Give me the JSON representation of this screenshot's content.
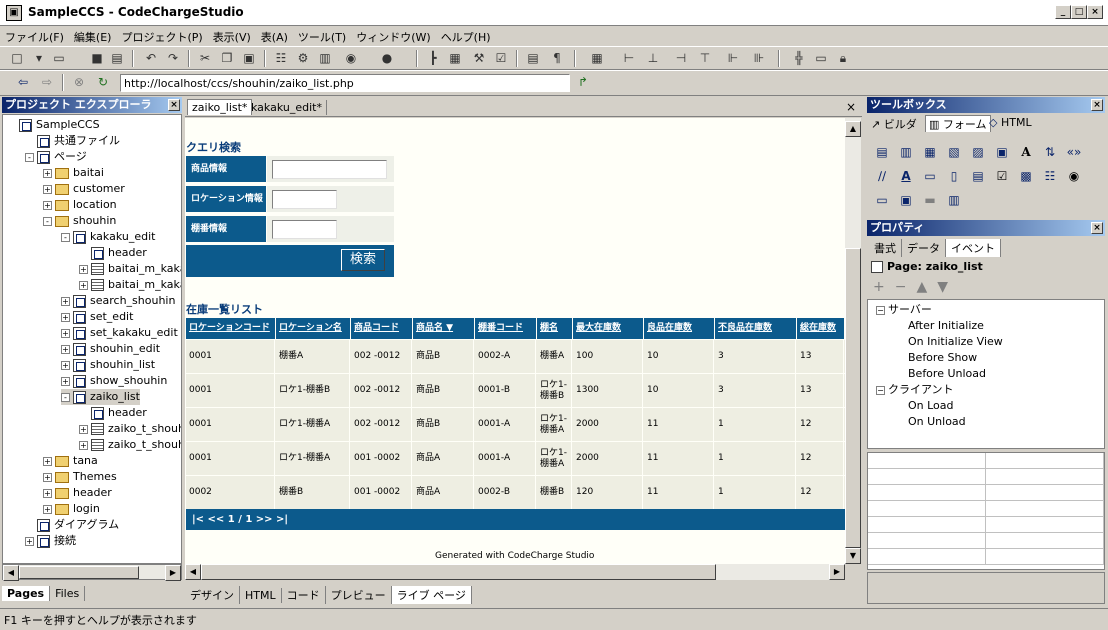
{
  "window": {
    "title": "SampleCCS - CodeChargeStudio",
    "app_icon_glyph": "▣"
  },
  "menu": [
    "ファイル(F)",
    "編集(E)",
    "プロジェクト(P)",
    "表示(V)",
    "表(A)",
    "ツール(T)",
    "ウィンドウ(W)",
    "ヘルプ(H)"
  ],
  "address": {
    "url": "http://localhost/ccs/shouhin/zaiko_list.php"
  },
  "project_explorer": {
    "title": "プロジェクト エクスプローラ",
    "tree": [
      {
        "label": "SampleCCS",
        "icon": "project-icon"
      },
      {
        "label": "共通ファイル",
        "icon": "page-icon"
      },
      {
        "label": "ページ",
        "icon": "pages-icon"
      },
      {
        "label": "baitai",
        "icon": "folder-icon"
      },
      {
        "label": "customer",
        "icon": "folder-icon"
      },
      {
        "label": "location",
        "icon": "folder-icon"
      },
      {
        "label": "shouhin",
        "icon": "folder-icon"
      },
      {
        "label": "kakaku_edit",
        "icon": "page-icon"
      },
      {
        "label": "header",
        "icon": "page-icon"
      },
      {
        "label": "baitai_m_kakak",
        "icon": "form-icon"
      },
      {
        "label": "baitai_m_kakak",
        "icon": "grid-icon"
      },
      {
        "label": "search_shouhin",
        "icon": "page-icon"
      },
      {
        "label": "set_edit",
        "icon": "page-icon"
      },
      {
        "label": "set_kakaku_edit",
        "icon": "page-icon"
      },
      {
        "label": "shouhin_edit",
        "icon": "page-icon"
      },
      {
        "label": "shouhin_list",
        "icon": "page-icon"
      },
      {
        "label": "show_shouhin",
        "icon": "page-icon"
      },
      {
        "label": "zaiko_list",
        "icon": "page-icon"
      },
      {
        "label": "header",
        "icon": "page-icon"
      },
      {
        "label": "zaiko_t_shouhi",
        "icon": "form-icon"
      },
      {
        "label": "zaiko_t_shouhi",
        "icon": "grid-icon"
      },
      {
        "label": "tana",
        "icon": "folder-icon"
      },
      {
        "label": "Themes",
        "icon": "folder-icon"
      },
      {
        "label": "header",
        "icon": "folder-icon"
      },
      {
        "label": "login",
        "icon": "folder-icon"
      },
      {
        "label": "ダイアグラム",
        "icon": "diagram-icon"
      },
      {
        "label": "接続",
        "icon": "connection-icon"
      }
    ],
    "tabs": [
      "Pages",
      "Files"
    ]
  },
  "editor": {
    "tabs": [
      "zaiko_list*",
      "kakaku_edit*"
    ],
    "bottom_tabs": [
      "デザイン",
      "HTML",
      "コード",
      "プレビュー",
      "ライブ ページ"
    ],
    "search_form": {
      "title": "クエリ検索",
      "fields": [
        "商品情報",
        "ロケーション情報",
        "棚番情報"
      ],
      "button": "検索"
    },
    "grid": {
      "title": "在庫一覧リスト",
      "columns": [
        "ロケーションコード",
        "ロケーション名",
        "商品コード",
        "商品名 ▼",
        "棚番コード",
        "棚名",
        "最大在庫数",
        "良品在庫数",
        "不良品在庫数",
        "総在庫数"
      ],
      "rows": [
        [
          "0001",
          "棚番A",
          "002 -0012",
          "商品B",
          "0002-A",
          "棚番A",
          "100",
          "10",
          "3",
          "13"
        ],
        [
          "0001",
          "ロケ1-棚番B",
          "002 -0012",
          "商品B",
          "0001-B",
          "ロケ1-棚番B",
          "1300",
          "10",
          "3",
          "13"
        ],
        [
          "0001",
          "ロケ1-棚番A",
          "002 -0012",
          "商品B",
          "0001-A",
          "ロケ1-棚番A",
          "2000",
          "11",
          "1",
          "12"
        ],
        [
          "0001",
          "ロケ1-棚番A",
          "001 -0002",
          "商品A",
          "0001-A",
          "ロケ1-棚番A",
          "2000",
          "11",
          "1",
          "12"
        ],
        [
          "0002",
          "棚番B",
          "001 -0002",
          "商品A",
          "0002-B",
          "棚番B",
          "120",
          "11",
          "1",
          "12"
        ]
      ],
      "pager": "|< << 1 / 1 >> >|"
    },
    "footer": "Generated with CodeCharge Studio"
  },
  "toolbox": {
    "title": "ツールボックス",
    "tabs": [
      "ビルダ",
      "フォーム",
      "HTML"
    ]
  },
  "properties": {
    "title": "プロパティ",
    "tabs": [
      "書式",
      "データ",
      "イベント"
    ],
    "page_label": "Page: zaiko_list",
    "events": [
      {
        "label": "サーバー",
        "level": 0
      },
      {
        "label": "After Initialize",
        "level": 1
      },
      {
        "label": "On Initialize View",
        "level": 1
      },
      {
        "label": "Before Show",
        "level": 1
      },
      {
        "label": "Before Unload",
        "level": 1
      },
      {
        "label": "クライアント",
        "level": 0
      },
      {
        "label": "On Load",
        "level": 1
      },
      {
        "label": "On Unload",
        "level": 1
      }
    ]
  },
  "status": {
    "text": "F1 キーを押すとヘルプが表示されます"
  },
  "colors": {
    "accent": "#0c5a8c",
    "panel_head": "#0a246a",
    "chrome": "#d4d0c8"
  }
}
